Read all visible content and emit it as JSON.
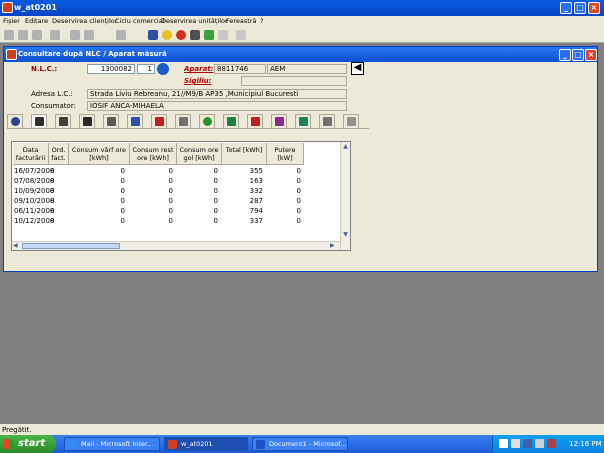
{
  "app": {
    "title": "w_at0201"
  },
  "menu": [
    "Fișier",
    "Editare",
    "Deservirea clienților",
    "Ciclu comercial",
    "Deservirea unităților",
    "Fereastră",
    "?"
  ],
  "form": {
    "title": "Consultare după NLC / Aparat măsură",
    "nlc_label": "N.L.C.:",
    "nlc_value": "1300082",
    "nlc_seq": "1",
    "aparat_label": "Aparat:",
    "aparat_code": "8811746",
    "aparat_type": "AEM",
    "sigiliu_label": "Sigiliu:",
    "sigiliu_value": "",
    "adresa_label": "Adresa L.C.:",
    "adresa_value": "Strada Liviu Rebreanu, 21//M9/B AP35 ,Municipiul Bucuresti",
    "consumator_label": "Consumator:",
    "consumator_value": "IOSIF  ANCA-MIHAELA"
  },
  "grid": {
    "headers": [
      "Data facturării",
      "Ord. fact.",
      "Consum vârf ore [kWh]",
      "Consum rest ore [kWh]",
      "Consum ore gol [kWh]",
      "Total [kWh]",
      "Putere [kW]"
    ],
    "rows": [
      [
        "16/07/2008",
        "0",
        "0",
        "0",
        "0",
        "355",
        "0"
      ],
      [
        "07/08/2008",
        "0",
        "0",
        "0",
        "0",
        "163",
        "0"
      ],
      [
        "10/09/2008",
        "0",
        "0",
        "0",
        "0",
        "332",
        "0"
      ],
      [
        "09/10/2008",
        "0",
        "0",
        "0",
        "0",
        "287",
        "0"
      ],
      [
        "06/11/2008",
        "0",
        "0",
        "0",
        "0",
        "794",
        "0"
      ],
      [
        "10/12/2008",
        "0",
        "0",
        "0",
        "0",
        "337",
        "0"
      ]
    ]
  },
  "status": "Pregătit.",
  "taskbar": {
    "start": "start",
    "items": [
      "Mail - Microsoft Inter...",
      "w_at0201",
      "Document1 - Microsof..."
    ],
    "clock": "12:16 PM"
  }
}
